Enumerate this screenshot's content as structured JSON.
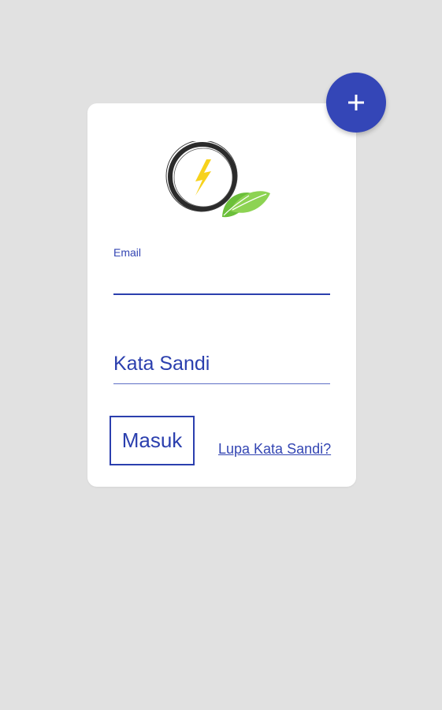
{
  "colors": {
    "accent": "#3446b7",
    "background": "#e1e1e1",
    "card": "#ffffff",
    "bolt": "#f7d21c",
    "leaf": "#7cc843"
  },
  "logo": {
    "icon": "lightning-leaf-logo"
  },
  "form": {
    "email_label": "Email",
    "email_value": "",
    "password_placeholder": "Kata Sandi",
    "password_value": "",
    "submit_label": "Masuk",
    "forgot_label": "Lupa Kata Sandi?"
  },
  "fab": {
    "icon": "plus-icon"
  }
}
